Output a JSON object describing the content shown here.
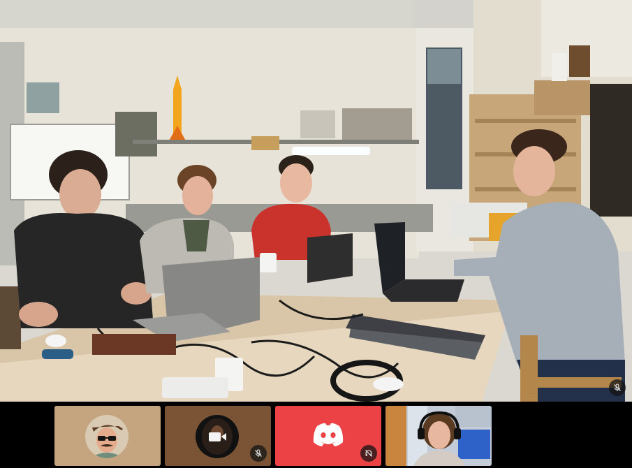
{
  "call": {
    "main_participant": {
      "role": "video-stream",
      "muted": true
    },
    "participants": [
      {
        "kind": "avatar",
        "description_icon": "avatar-sunglasses-hat",
        "muted": false,
        "tile_color": "#c4a57f"
      },
      {
        "kind": "avatar",
        "description_icon": "avatar-camera-off",
        "muted": true,
        "tile_color": "#7a5434"
      },
      {
        "kind": "logo",
        "description_icon": "discord-logo-icon",
        "muted": true,
        "tile_color": "#ed4245"
      },
      {
        "kind": "video",
        "description_icon": "webcam-video",
        "muted": false,
        "tile_color": "#9aa7ba"
      }
    ]
  },
  "colors": {
    "discord_red": "#ed4245",
    "background": "#000000",
    "mute_badge": "#141414"
  }
}
